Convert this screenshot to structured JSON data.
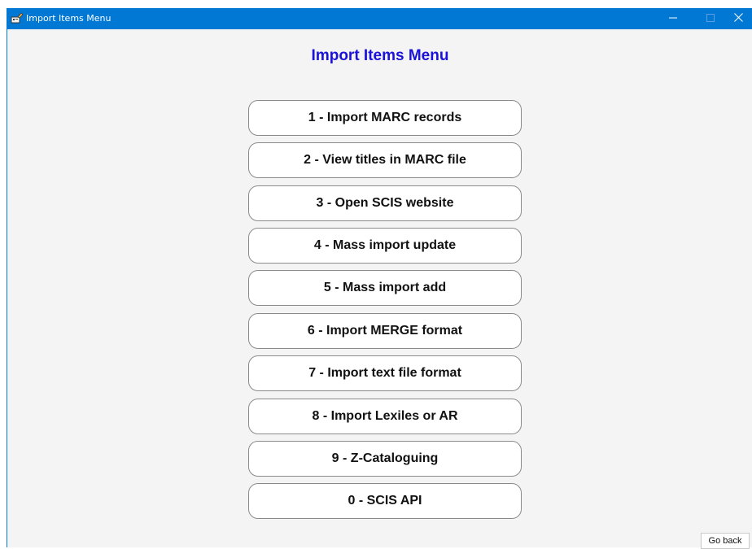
{
  "window": {
    "title": "Import Items Menu",
    "accent_color": "#0078d4",
    "controls": {
      "minimize_icon": "minimize-icon",
      "maximize_icon": "maximize-icon",
      "close_icon": "close-icon"
    }
  },
  "header": {
    "title": "Import Items Menu",
    "title_color": "#1a12d8"
  },
  "menu": {
    "items": [
      {
        "label": "1 - Import MARC records"
      },
      {
        "label": "2 - View titles in MARC file"
      },
      {
        "label": "3 - Open SCIS website"
      },
      {
        "label": "4 - Mass import update"
      },
      {
        "label": "5 - Mass import add"
      },
      {
        "label": "6 - Import MERGE format"
      },
      {
        "label": "7 - Import text file format"
      },
      {
        "label": "8 - Import Lexiles or AR"
      },
      {
        "label": "9 - Z-Cataloguing"
      },
      {
        "label": "0 - SCIS API"
      }
    ]
  },
  "footer": {
    "go_back_label": "Go back"
  }
}
